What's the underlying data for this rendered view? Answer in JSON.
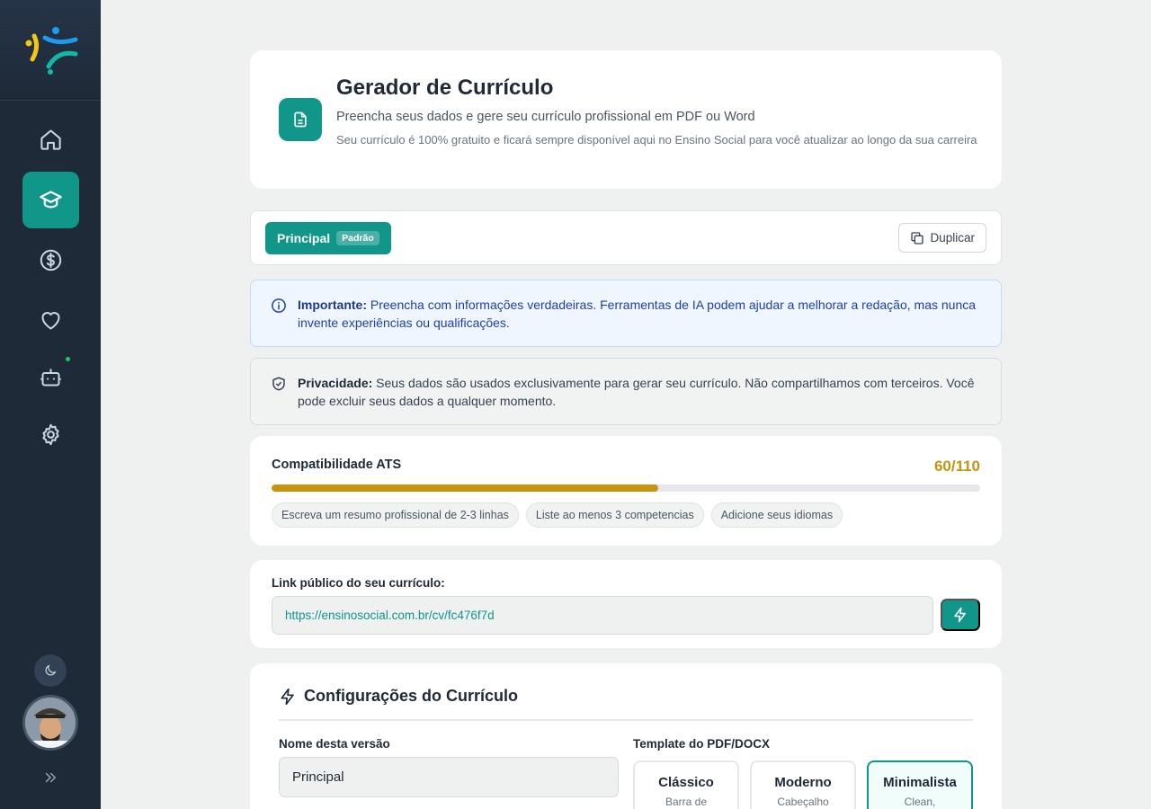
{
  "header": {
    "title": "Gerador de Currículo",
    "subtitle": "Preencha seus dados e gere seu currículo profissional em PDF ou Word",
    "note": "Seu currículo é 100% gratuito e ficará sempre disponível aqui no Ensino Social para você atualizar ao longo da sua carreira"
  },
  "versions": {
    "active_tab": "Principal",
    "default_badge": "Padrão",
    "duplicate_label": "Duplicar"
  },
  "alerts": {
    "info_title": "Importante:",
    "info_text": " Preencha com informações verdadeiras. Ferramentas de IA podem ajudar a melhorar a redação, mas nunca invente experiências ou qualificações.",
    "privacy_title": "Privacidade:",
    "privacy_text": " Seus dados são usados exclusivamente para gerar seu currículo. Não compartilhamos com terceiros. Você pode excluir seus dados a qualquer momento."
  },
  "ats": {
    "title": "Compatibilidade ATS",
    "score": "60/110",
    "progress_fraction": 0.5455,
    "tips": [
      "Escreva um resumo profissional de 2-3 linhas",
      "Liste ao menos 3 competencias",
      "Adicione seus idiomas"
    ]
  },
  "public_link": {
    "label": "Link público do seu currículo:",
    "url": "https://ensinosocial.com.br/cv/fc476f7d"
  },
  "config": {
    "title": "Configurações do Currículo",
    "name_label": "Nome desta versão",
    "name_value": "Principal",
    "template_label": "Template do PDF/DOCX",
    "templates": [
      {
        "name": "Clássico",
        "desc": "Barra de"
      },
      {
        "name": "Moderno",
        "desc": "Cabeçalho"
      },
      {
        "name": "Minimalista",
        "desc": "Clean,"
      }
    ],
    "selected_template": 2
  },
  "colors": {
    "accent": "#11968a",
    "sidebar": "#1e2a38",
    "ats_bar": "#c8930f"
  },
  "sidebar_icons": [
    "home-icon",
    "graduation-cap-icon",
    "dollar-icon",
    "heart-icon",
    "bot-icon",
    "gear-icon"
  ]
}
